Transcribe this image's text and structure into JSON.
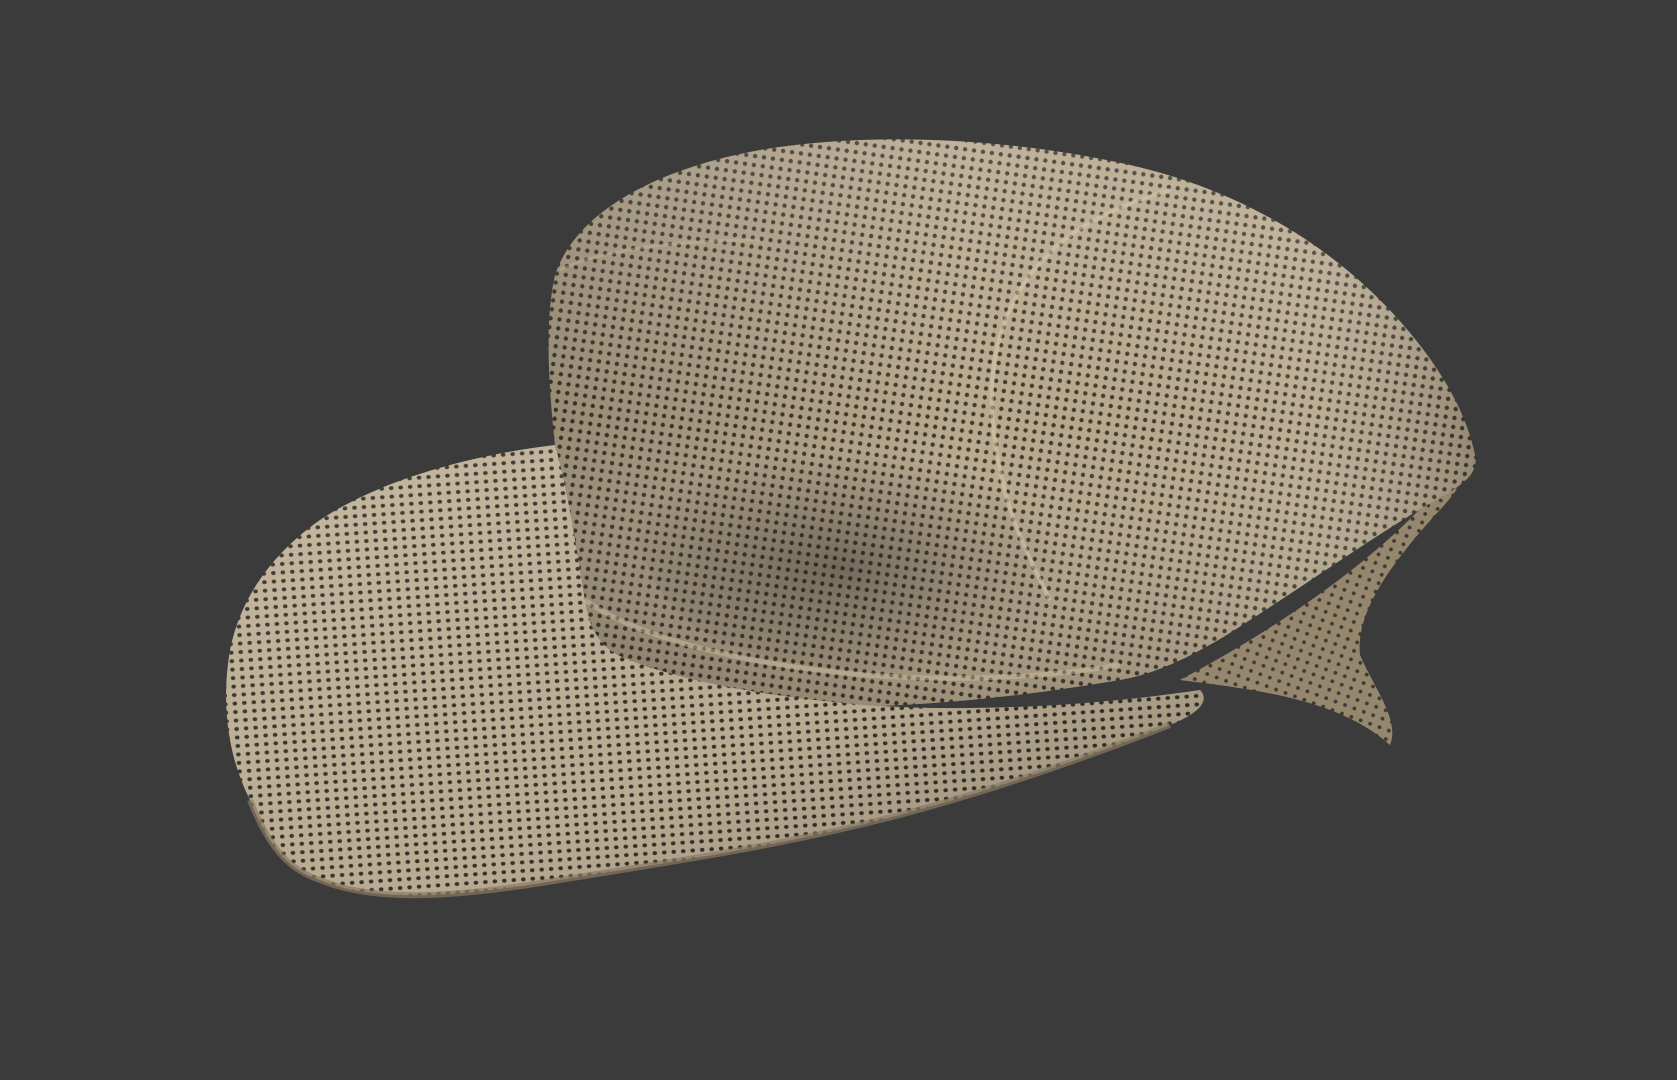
{
  "scene": {
    "background_color": "#3b3b3b",
    "object": {
      "type": "mesh-cap",
      "material": "perforated-mesh",
      "base_color": "#b5a58a",
      "shadow_color": "#7e6e58",
      "highlight_color": "#d9c9ae",
      "hole_color": "#3a3732"
    }
  }
}
